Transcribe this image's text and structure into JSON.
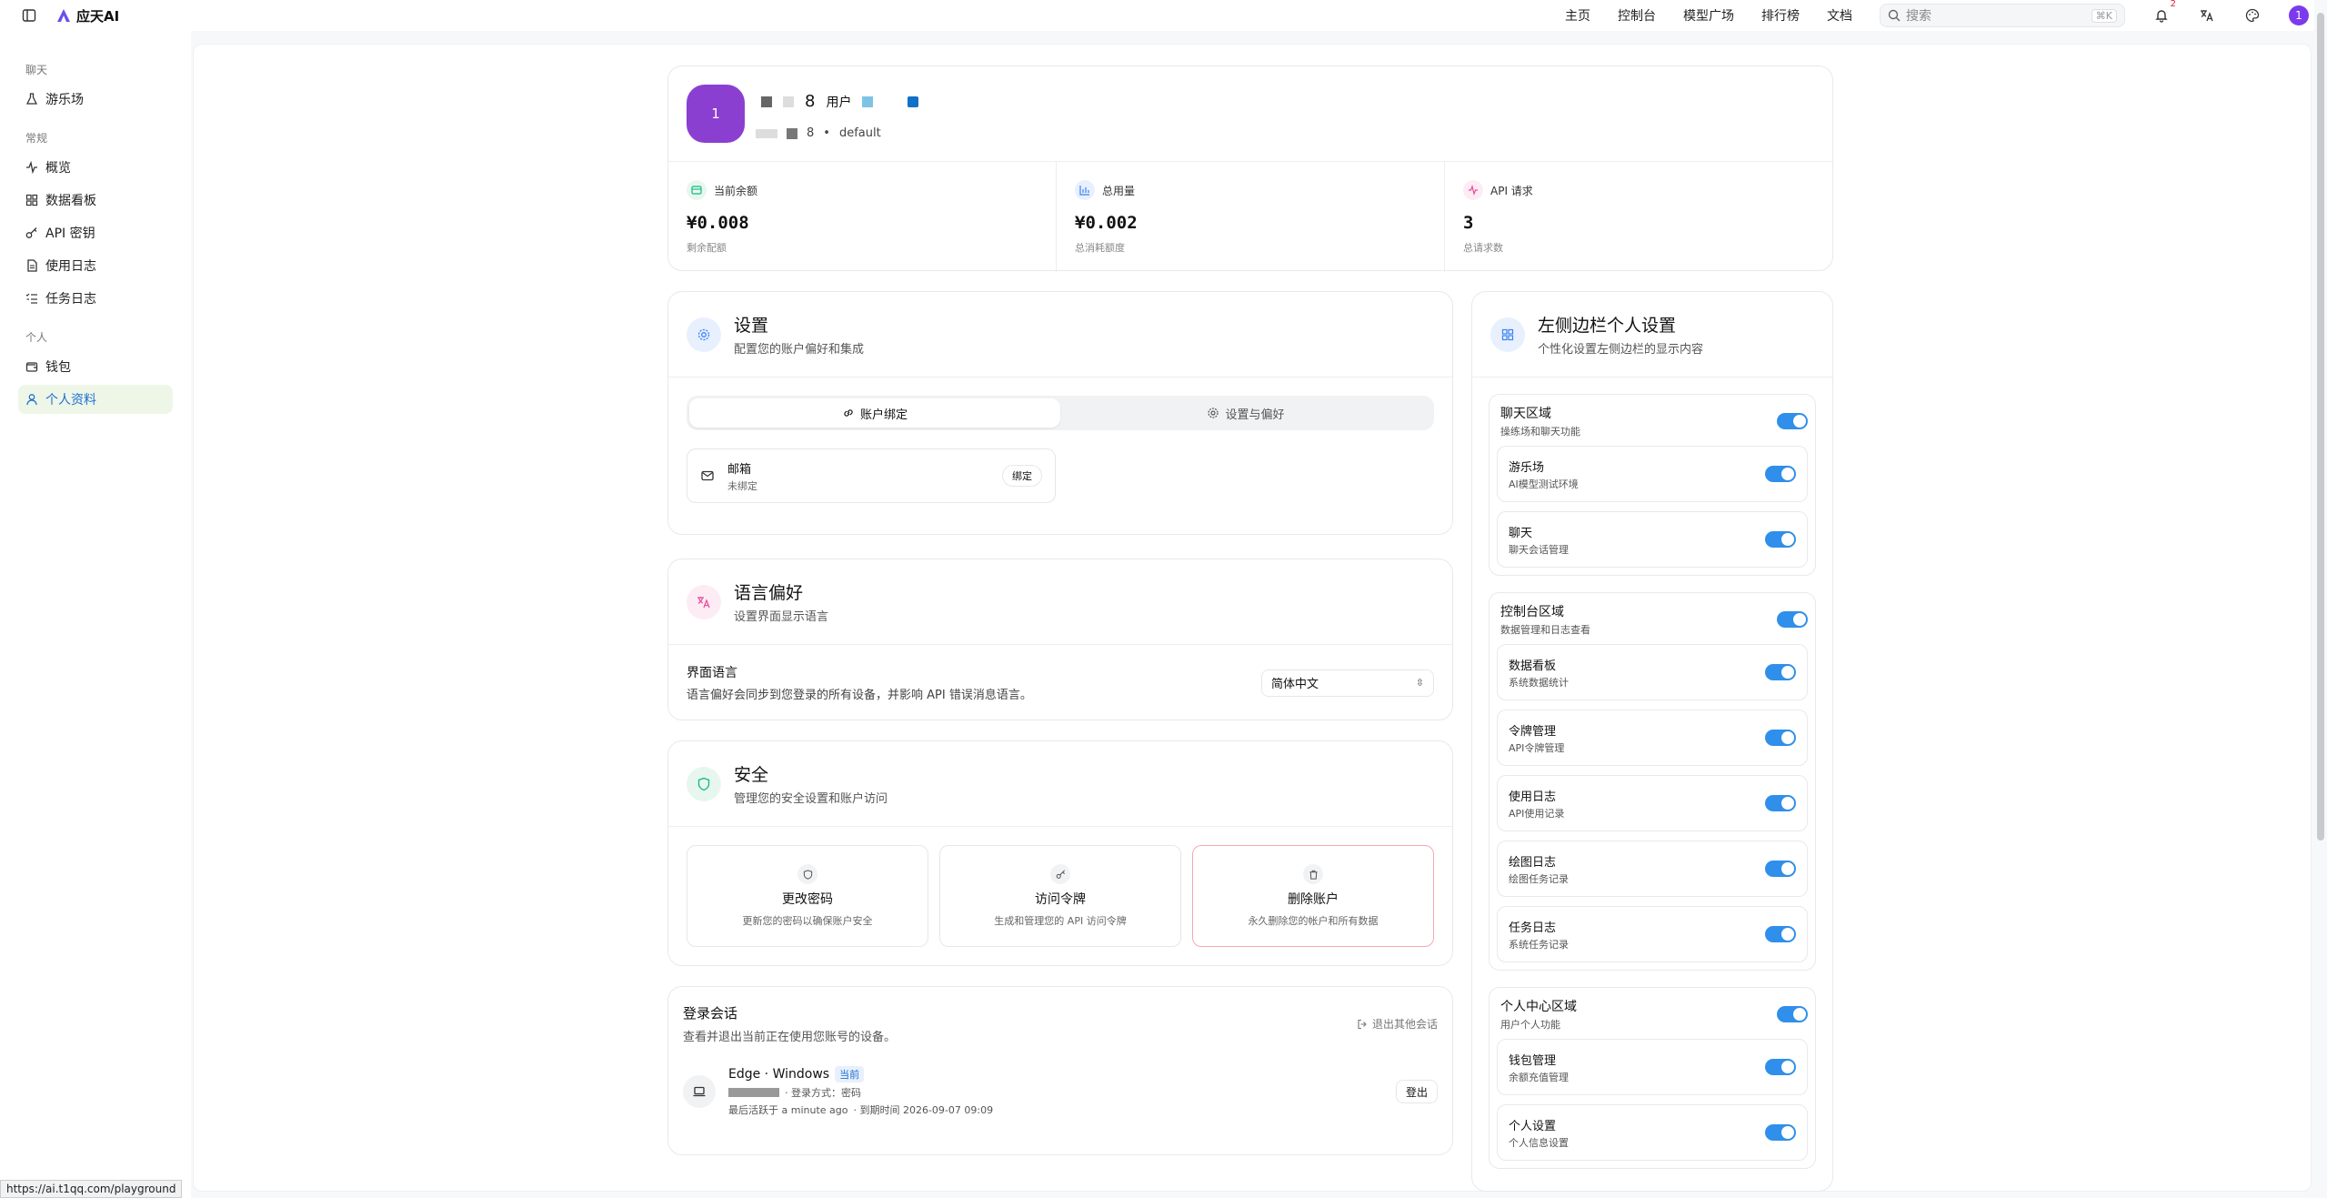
{
  "app": {
    "name": "应天AI",
    "avatar_initial": "1",
    "notif_count": "2"
  },
  "topnav": [
    "主页",
    "控制台",
    "模型广场",
    "排行榜",
    "文档"
  ],
  "search": {
    "placeholder": "搜索",
    "shortcut": "⌘K"
  },
  "sidebar": {
    "sections": [
      {
        "title": "聊天",
        "items": [
          {
            "label": "游乐场",
            "icon": "flask-icon"
          }
        ]
      },
      {
        "title": "常规",
        "items": [
          {
            "label": "概览",
            "icon": "activity-icon"
          },
          {
            "label": "数据看板",
            "icon": "dashboard-icon"
          },
          {
            "label": "API 密钥",
            "icon": "key-icon"
          },
          {
            "label": "使用日志",
            "icon": "file-icon"
          },
          {
            "label": "任务日志",
            "icon": "list-icon"
          }
        ]
      },
      {
        "title": "个人",
        "items": [
          {
            "label": "钱包",
            "icon": "wallet-icon"
          },
          {
            "label": "个人资料",
            "icon": "user-icon",
            "active": true
          }
        ]
      }
    ]
  },
  "profile": {
    "avatar": "1",
    "name_fragment": "8",
    "role": "用户",
    "sub_fragment": "8",
    "group": "default",
    "stats": [
      {
        "label": "当前余额",
        "value": "¥0.008",
        "caption": "剩余配额",
        "color": "#10b981"
      },
      {
        "label": "总用量",
        "value": "¥0.002",
        "caption": "总消耗额度",
        "color": "#3b82f6"
      },
      {
        "label": "API 请求",
        "value": "3",
        "caption": "总请求数",
        "color": "#ec4899"
      }
    ]
  },
  "settings": {
    "title": "设置",
    "subtitle": "配置您的账户偏好和集成",
    "tabs": [
      "账户绑定",
      "设置与偏好"
    ],
    "email": {
      "title": "邮箱",
      "status": "未绑定",
      "button": "绑定"
    }
  },
  "language": {
    "title": "语言偏好",
    "subtitle": "设置界面显示语言",
    "field_label": "界面语言",
    "field_desc": "语言偏好会同步到您登录的所有设备，并影响 API 错误消息语言。",
    "selected": "简体中文"
  },
  "security": {
    "title": "安全",
    "subtitle": "管理您的安全设置和账户访问",
    "items": [
      {
        "title": "更改密码",
        "desc": "更新您的密码以确保账户安全"
      },
      {
        "title": "访问令牌",
        "desc": "生成和管理您的 API 访问令牌"
      },
      {
        "title": "删除账户",
        "desc": "永久删除您的帐户和所有数据"
      }
    ]
  },
  "sessions": {
    "title": "登录会话",
    "subtitle": "查看并退出当前正在使用您账号的设备。",
    "logout_others": "退出其他会话",
    "device": "Edge · Windows",
    "current_badge": "当前",
    "login_method": "· 登录方式：密码",
    "last_active": "最后活跃于 a minute ago",
    "expires": "· 到期时间 2026-09-07 09:09",
    "logout_button": "登出"
  },
  "sidebar_settings": {
    "title": "左侧边栏个人设置",
    "subtitle": "个性化设置左侧边栏的显示内容",
    "groups": [
      {
        "title": "聊天区域",
        "sub": "操练场和聊天功能",
        "items": [
          {
            "t": "游乐场",
            "s": "AI模型测试环境"
          },
          {
            "t": "聊天",
            "s": "聊天会话管理"
          }
        ]
      },
      {
        "title": "控制台区域",
        "sub": "数据管理和日志查看",
        "items": [
          {
            "t": "数据看板",
            "s": "系统数据统计"
          },
          {
            "t": "令牌管理",
            "s": "API令牌管理"
          },
          {
            "t": "使用日志",
            "s": "API使用记录"
          },
          {
            "t": "绘图日志",
            "s": "绘图任务记录"
          },
          {
            "t": "任务日志",
            "s": "系统任务记录"
          }
        ]
      },
      {
        "title": "个人中心区域",
        "sub": "用户个人功能",
        "items": [
          {
            "t": "钱包管理",
            "s": "余额充值管理"
          },
          {
            "t": "个人设置",
            "s": "个人信息设置"
          }
        ]
      }
    ]
  },
  "status_url": "https://ai.t1qq.com/playground"
}
